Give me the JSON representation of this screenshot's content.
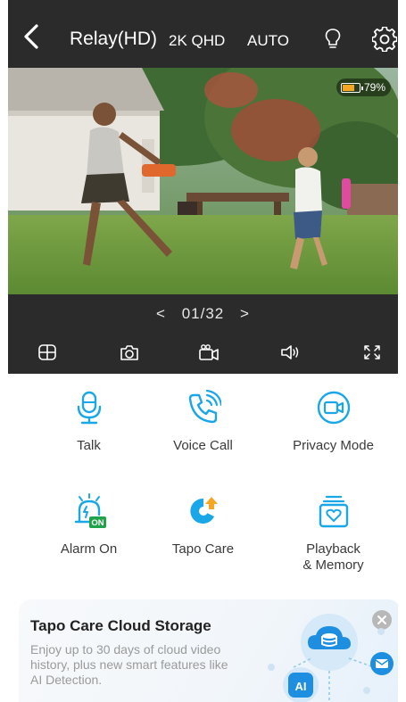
{
  "header": {
    "title": "Relay(HD)",
    "resolution": "2K QHD",
    "mode": "AUTO"
  },
  "video": {
    "battery_text": "79%",
    "battery_level": 0.79
  },
  "playback": {
    "prev": "<",
    "position": "01/32",
    "next": ">"
  },
  "features": [
    {
      "label": "Talk",
      "icon": "microphone-icon"
    },
    {
      "label": "Voice Call",
      "icon": "phone-call-icon"
    },
    {
      "label": "Privacy Mode",
      "icon": "privacy-camera-icon"
    },
    {
      "label": "Alarm On",
      "icon": "alarm-icon",
      "badge": "ON"
    },
    {
      "label": "Tapo Care",
      "icon": "tapo-care-icon"
    },
    {
      "label": "Playback\n& Memory",
      "icon": "playback-memory-icon"
    }
  ],
  "promo": {
    "title": "Tapo Care Cloud Storage",
    "description": "Enjoy up to 30 days of cloud video history, plus new smart features like AI Detection.",
    "ai_label": "AI"
  },
  "colors": {
    "accent": "#19a7e8",
    "dark_bar": "#2b2b2b",
    "battery": "#f5a623",
    "badge_green": "#1fa34a"
  }
}
